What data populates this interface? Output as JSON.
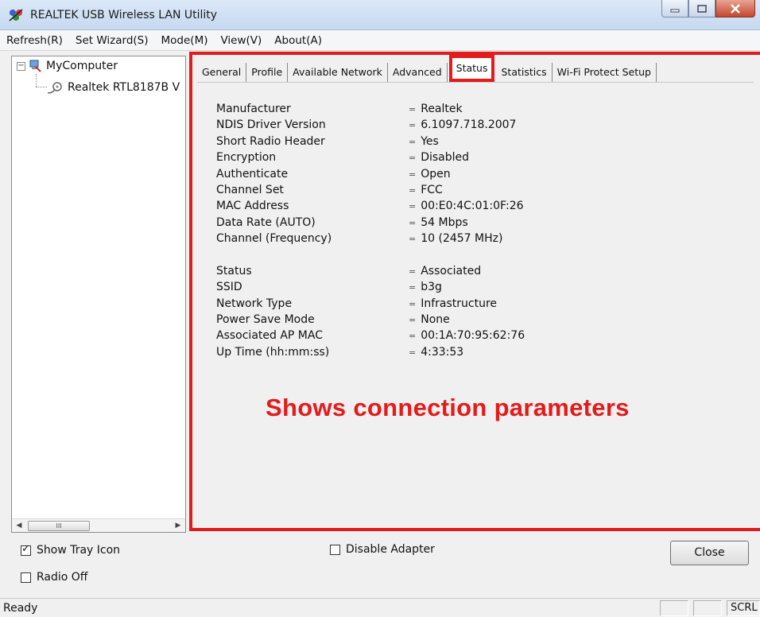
{
  "window": {
    "title": "REALTEK USB Wireless LAN Utility"
  },
  "menu": [
    "Refresh(R)",
    "Set Wizard(S)",
    "Mode(M)",
    "View(V)",
    "About(A)"
  ],
  "tree": {
    "root": "MyComputer",
    "child": "Realtek RTL8187B V",
    "scroll_thumb": "III"
  },
  "tabs": [
    {
      "label": "General",
      "active": false
    },
    {
      "label": "Profile",
      "active": false
    },
    {
      "label": "Available Network",
      "active": false
    },
    {
      "label": "Advanced",
      "active": false
    },
    {
      "label": "Status",
      "active": true
    },
    {
      "label": "Statistics",
      "active": false
    },
    {
      "label": "Wi-Fi Protect Setup",
      "active": false
    }
  ],
  "status_info": {
    "group1": [
      {
        "label": "Manufacturer",
        "value": "Realtek"
      },
      {
        "label": "NDIS Driver Version",
        "value": "6.1097.718.2007"
      },
      {
        "label": "Short Radio Header",
        "value": "Yes"
      },
      {
        "label": "Encryption",
        "value": "Disabled"
      },
      {
        "label": "Authenticate",
        "value": "Open"
      },
      {
        "label": "Channel Set",
        "value": "FCC"
      },
      {
        "label": "MAC Address",
        "value": "00:E0:4C:01:0F:26"
      },
      {
        "label": "Data Rate (AUTO)",
        "value": "54 Mbps"
      },
      {
        "label": "Channel (Frequency)",
        "value": "10 (2457 MHz)"
      }
    ],
    "group2": [
      {
        "label": "Status",
        "value": "Associated"
      },
      {
        "label": "SSID",
        "value": "b3g"
      },
      {
        "label": "Network Type",
        "value": "Infrastructure"
      },
      {
        "label": "Power Save Mode",
        "value": "None"
      },
      {
        "label": "Associated AP MAC",
        "value": "00:1A:70:95:62:76"
      },
      {
        "label": "Up Time (hh:mm:ss)",
        "value": "4:33:53"
      }
    ]
  },
  "annotation": "Shows connection parameters",
  "options": {
    "show_tray_icon": {
      "label": "Show Tray Icon",
      "checked": true
    },
    "radio_off": {
      "label": "Radio Off",
      "checked": false
    },
    "disable_adapter": {
      "label": "Disable Adapter",
      "checked": false
    }
  },
  "close_label": "Close",
  "statusbar": {
    "text": "Ready",
    "pane3": "SCRL"
  },
  "colors": {
    "highlight": "#e31b1b",
    "titlebar": "#c5d9f0"
  }
}
